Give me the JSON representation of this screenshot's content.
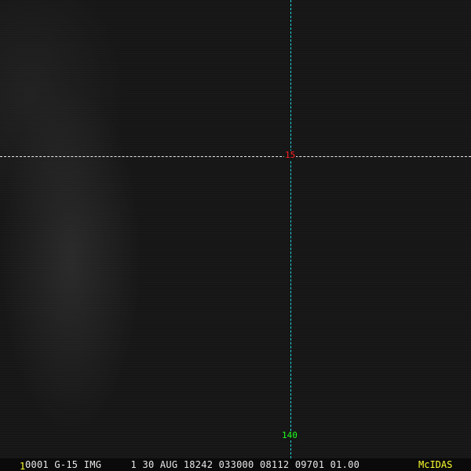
{
  "overlay": {
    "latitude_label": "15",
    "longitude_label": "140",
    "colors": {
      "lat_line": "#e8e8e8",
      "lon_line": "#22d3e0",
      "lat_label": "#ff2020",
      "lon_label": "#20ff20"
    }
  },
  "status_bar": {
    "frame_number": "1",
    "info": "0001 G-15 IMG     1 30 AUG 18242 033000 08112 09701 01.00",
    "brand": "McIDAS"
  }
}
